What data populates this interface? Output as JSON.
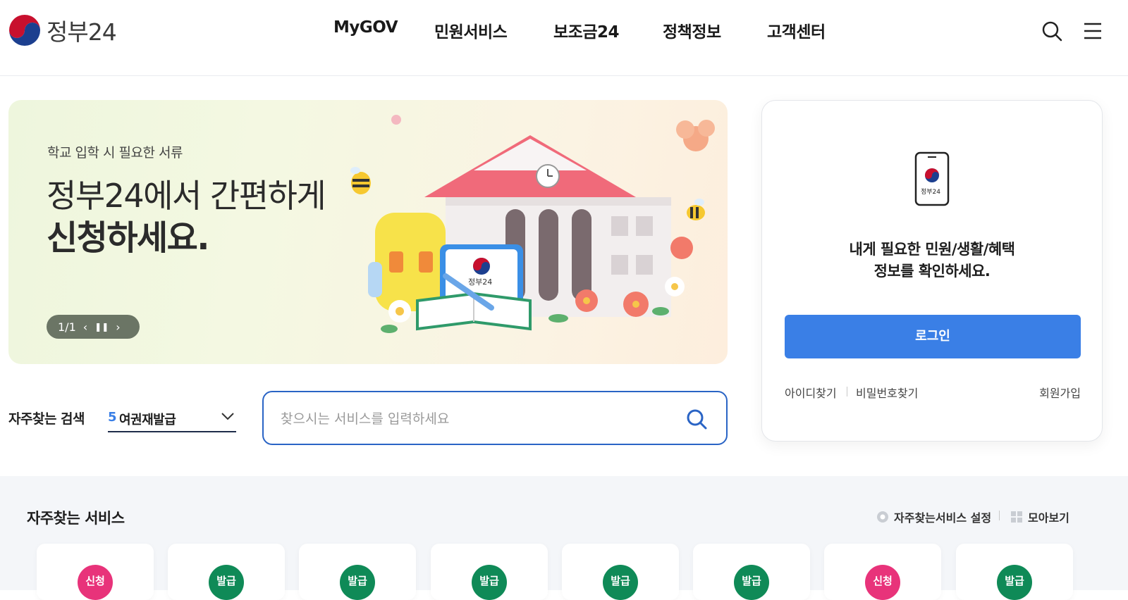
{
  "header": {
    "logo_text": "정부24",
    "nav": [
      {
        "label": "MyGOV"
      },
      {
        "label": "민원서비스"
      },
      {
        "label": "보조금24"
      },
      {
        "label": "정책정보"
      },
      {
        "label": "고객센터"
      }
    ],
    "search_icon": "search-icon",
    "menu_icon": "hamburger-menu-icon"
  },
  "hero": {
    "subtitle": "학교 입학 시 필요한 서류",
    "title_line1": "정부24에서 간편하게",
    "title_line2": "신청하세요.",
    "pager": "1/1",
    "badge_text": "정부24"
  },
  "login": {
    "phone_label": "정부24",
    "message_line1": "내게 필요한 민원/생활/혜택",
    "message_line2": "정보를 확인하세요.",
    "login_button": "로그인",
    "find_id": "아이디찾기",
    "find_password": "비밀번호찾기",
    "signup": "회원가입"
  },
  "search": {
    "frequent_label": "자주찾는 검색",
    "frequent_rank": "5",
    "frequent_value": "여권재발급",
    "placeholder": "찾으시는 서비스를 입력하세요"
  },
  "services": {
    "title": "자주찾는 서비스",
    "settings_label": "자주찾는서비스 설정",
    "view_all_label": "모아보기",
    "cards": [
      {
        "badge": "신청",
        "color": "#e8337a"
      },
      {
        "badge": "발급",
        "color": "#0f8a57"
      },
      {
        "badge": "발급",
        "color": "#0f8a57"
      },
      {
        "badge": "발급",
        "color": "#0f8a57"
      },
      {
        "badge": "발급",
        "color": "#0f8a57"
      },
      {
        "badge": "발급",
        "color": "#0f8a57"
      },
      {
        "badge": "신청",
        "color": "#e8337a"
      },
      {
        "badge": "발급",
        "color": "#0f8a57"
      }
    ]
  },
  "colors": {
    "primary": "#3a7fe6",
    "search_border": "#2a64c5",
    "apply_badge": "#e8337a",
    "issue_badge": "#0f8a57"
  }
}
